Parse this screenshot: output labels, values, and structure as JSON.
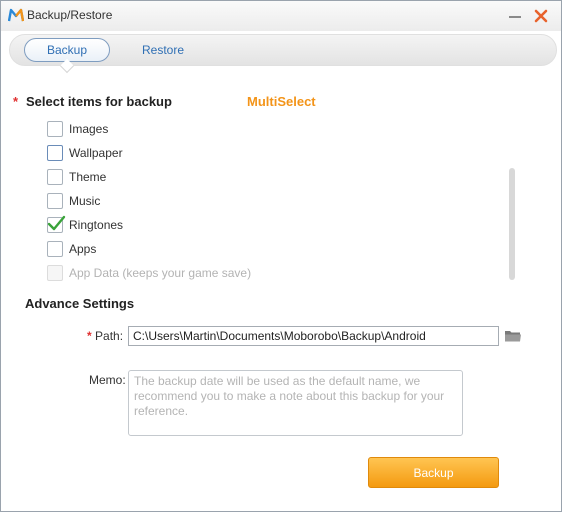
{
  "window": {
    "title": "Backup/Restore",
    "app_icon": "moborobo-logo-icon",
    "minimize_icon": "minimize-icon",
    "close_icon": "close-icon"
  },
  "tabs": [
    {
      "label": "Backup",
      "active": true
    },
    {
      "label": "Restore",
      "active": false
    }
  ],
  "select_section": {
    "required_mark": "*",
    "title": "Select items for backup",
    "multiselect_label": "MultiSelect",
    "items": [
      {
        "label": "Images",
        "checked": false,
        "disabled": false
      },
      {
        "label": "Wallpaper",
        "checked": false,
        "disabled": false
      },
      {
        "label": "Theme",
        "checked": false,
        "disabled": false
      },
      {
        "label": "Music",
        "checked": false,
        "disabled": false
      },
      {
        "label": "Ringtones",
        "checked": true,
        "disabled": false
      },
      {
        "label": "Apps",
        "checked": false,
        "disabled": false
      },
      {
        "label": "App Data (keeps your game save)",
        "checked": false,
        "disabled": true
      }
    ]
  },
  "advance_settings": {
    "title": "Advance Settings",
    "path": {
      "required_mark": "*",
      "label": "Path:",
      "value": "C:\\Users\\Martin\\Documents\\Moborobo\\Backup\\Android",
      "browse_icon": "folder-icon"
    },
    "memo": {
      "label": "Memo:",
      "placeholder": "The backup date will be used as the default name, we recommend you to make a note about this backup for your reference."
    }
  },
  "actions": {
    "backup_label": "Backup"
  },
  "colors": {
    "accent_orange": "#f39419",
    "tab_blue": "#2f6fb4",
    "required_red": "#e03030",
    "check_green": "#3aa33a",
    "close_orange": "#e8622c"
  }
}
